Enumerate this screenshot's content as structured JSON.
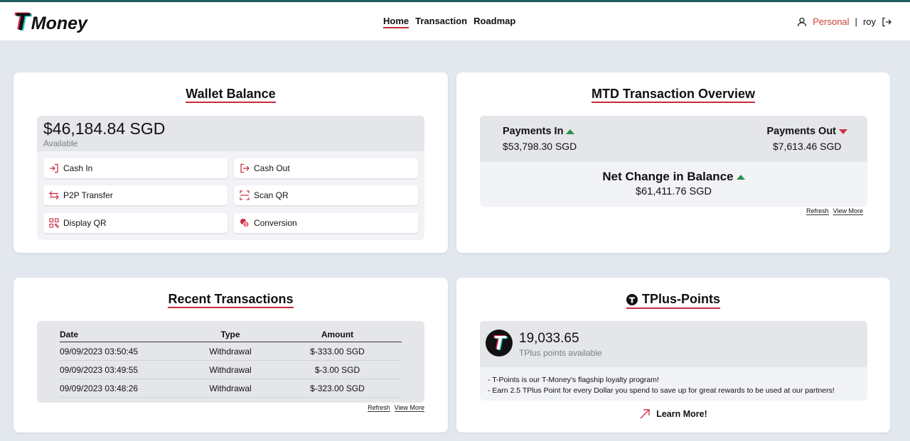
{
  "brand": {
    "logo_letter": "T",
    "logo_word": "Money"
  },
  "nav": {
    "home": "Home",
    "transaction": "Transaction",
    "roadmap": "Roadmap"
  },
  "user": {
    "account_type": "Personal",
    "separator": "|",
    "username": "roy"
  },
  "wallet": {
    "title": "Wallet Balance",
    "amount": "$46,184.84 SGD",
    "available_label": "Available",
    "actions": [
      "Cash In",
      "Cash Out",
      "P2P Transfer",
      "Scan QR",
      "Display QR",
      "Conversion"
    ]
  },
  "mtd": {
    "title": "MTD Transaction Overview",
    "payments_in_label": "Payments In",
    "payments_in_value": "$53,798.30 SGD",
    "payments_out_label": "Payments Out",
    "payments_out_value": "$7,613.46 SGD",
    "net_label": "Net Change in Balance",
    "net_value": "$61,411.76 SGD",
    "refresh": "Refresh",
    "view_more": "View More"
  },
  "recent": {
    "title": "Recent Transactions",
    "headers": [
      "Date",
      "Type",
      "Amount"
    ],
    "rows": [
      [
        "09/09/2023 03:50:45",
        "Withdrawal",
        "$-333.00 SGD"
      ],
      [
        "09/09/2023 03:49:55",
        "Withdrawal",
        "$-3.00 SGD"
      ],
      [
        "09/09/2023 03:48:26",
        "Withdrawal",
        "$-323.00 SGD"
      ]
    ],
    "refresh": "Refresh",
    "view_more": "View More"
  },
  "tplus": {
    "title": "TPlus-Points",
    "points": "19,033.65",
    "points_label": "TPlus points available",
    "desc_1": "- T-Points is our T-Money's flagship loyalty program!",
    "desc_2": "- Earn 2.5 TPlus Point for every Dollar you spend to save up for great rewards to be used at our partners!",
    "learn_more": "Learn More!"
  },
  "colors": {
    "accent": "#c62a3f",
    "up": "#2f8f4c",
    "down": "#d23047",
    "topbar": "#1f5e5c"
  }
}
